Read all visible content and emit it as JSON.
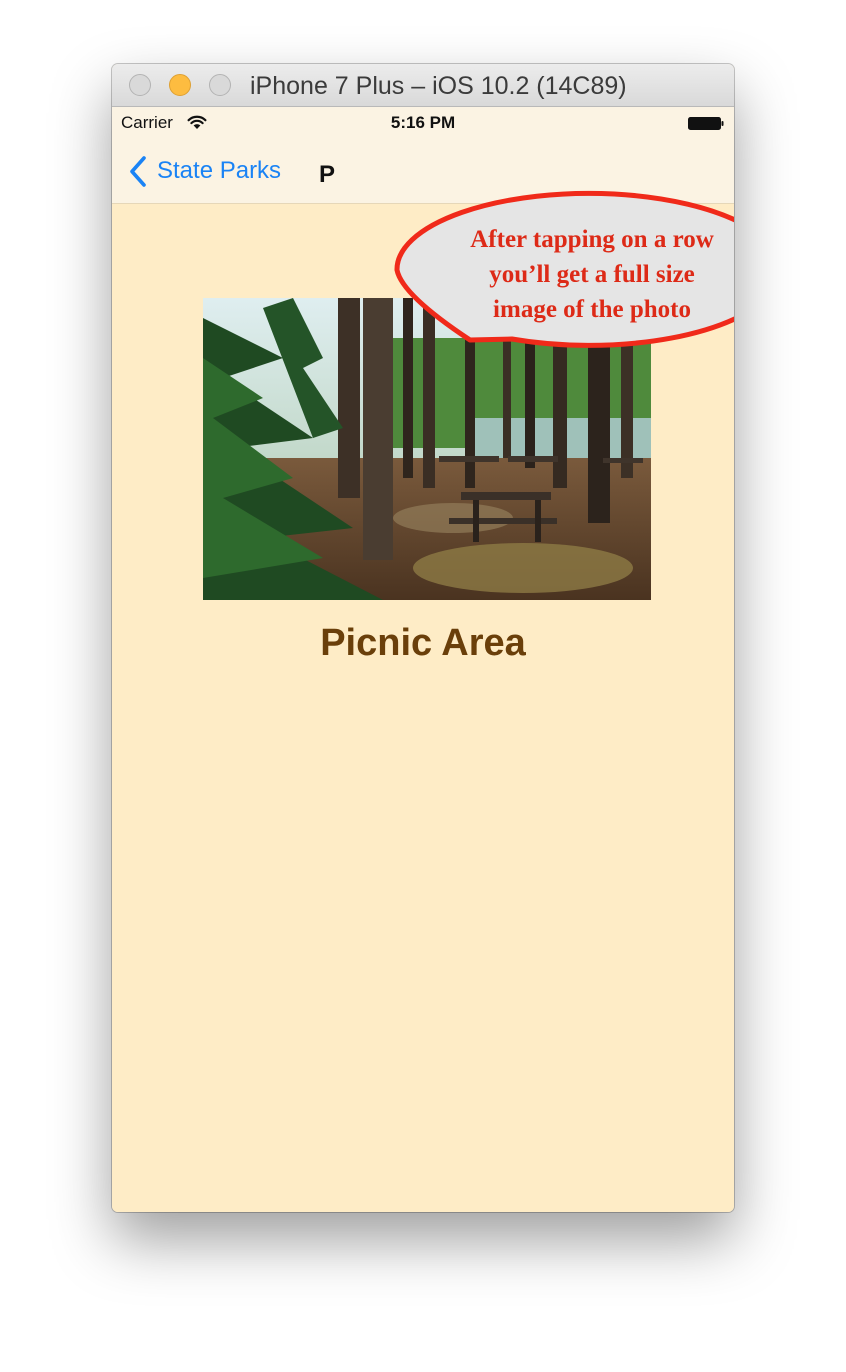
{
  "window": {
    "title": "iPhone 7 Plus – iOS 10.2 (14C89)"
  },
  "status_bar": {
    "carrier": "Carrier",
    "time": "5:16 PM"
  },
  "nav": {
    "back_label": "State Parks",
    "title": "P"
  },
  "detail": {
    "image_description": "photo",
    "caption": "Picnic Area"
  },
  "callout": {
    "lines": [
      "After tapping on a row",
      "you’ll get a full size",
      "image of the photo"
    ]
  },
  "colors": {
    "content_background": "#feecc6",
    "nav_background": "#fbf3e3",
    "tint": "#1a83f5",
    "caption": "#6a3f0a",
    "callout_text": "#dd2a17",
    "callout_border": "#f02a1a",
    "callout_fill": "#e5e5e5"
  },
  "icons": {
    "wifi": "wifi-icon",
    "battery": "battery-icon",
    "back": "chevron-left-icon"
  }
}
